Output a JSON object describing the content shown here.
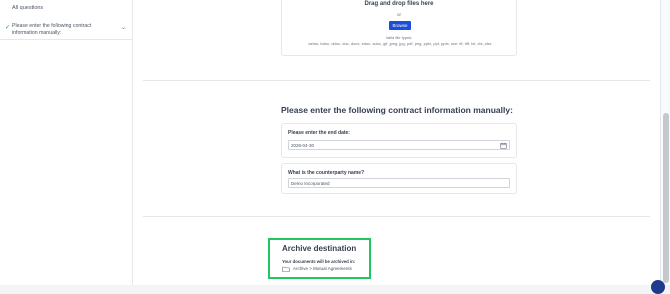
{
  "sidebar": {
    "all_questions": "All questions",
    "items": [
      {
        "label": "Please enter the following contract information manually:"
      }
    ]
  },
  "upload": {
    "title": "Drag and drop files here",
    "or": "or",
    "browse_label": "Browse",
    "valid_types_label": "Valid file types:",
    "valid_types": "aeiou, bdoc, ddoc, doc, docx, edoc, sdoc, gif, jpeg, jpg, pdf, png, pptx, ppt, pptx, sce, tif, tiff, txt, xls, xlsx"
  },
  "contract": {
    "title": "Please enter the following contract information manually:",
    "end_date": {
      "question": "Please enter the end date:",
      "value": "2026-04-30"
    },
    "counterparty": {
      "question": "What is the counterparty name?",
      "value": "Demo Incorporated"
    }
  },
  "archive": {
    "title": "Archive destination",
    "subtitle": "Your documents will be archived in:",
    "path": "Archive > Mutual Agreements",
    "highlight_color": "#22c55e"
  },
  "colors": {
    "primary": "#1d4ed8",
    "success": "#16a34a"
  }
}
